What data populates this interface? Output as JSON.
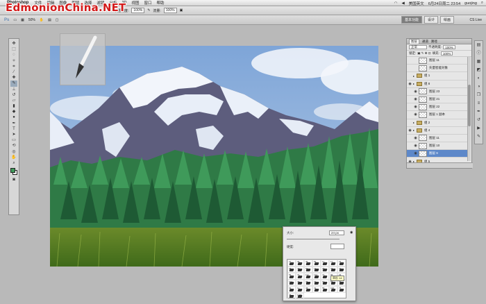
{
  "menubar": {
    "app": "Photoshop",
    "menus": [
      "文件",
      "编辑",
      "图像",
      "图层",
      "选择",
      "滤镜",
      "分析",
      "3D",
      "视图",
      "窗口",
      "帮助"
    ],
    "status_flag": "美国英文",
    "datetime": "6月24日周二 23:54",
    "user": "guojing"
  },
  "watermark": "EdmonionChina.NET",
  "optbar": {
    "opacity_label": "不透明度:",
    "opacity_value": "100%",
    "flow_label": "流量:",
    "flow_value": "100%"
  },
  "appbar": {
    "app_label": "Ps",
    "zoom": "50%",
    "workspaces": [
      "基本功能",
      "设计",
      "绘画"
    ],
    "cs_live": "CS Live"
  },
  "layers_panel": {
    "tabs": [
      "图层",
      "通道",
      "路径"
    ],
    "blend_mode": "正常",
    "opacity_label": "不透明度:",
    "opacity_value": "100%",
    "lock_label": "锁定:",
    "fill_label": "填充:",
    "fill_value": "100%",
    "rows": [
      {
        "name": "图层 11",
        "kind": "layer",
        "visible": false,
        "indent": true,
        "selected": false
      },
      {
        "name": "矢量智能对象",
        "kind": "layer",
        "visible": false,
        "indent": true,
        "selected": false
      },
      {
        "name": "组 1",
        "kind": "group",
        "visible": false,
        "indent": false,
        "selected": false
      },
      {
        "name": "组 8",
        "kind": "group",
        "visible": true,
        "indent": false,
        "selected": false
      },
      {
        "name": "图层 23",
        "kind": "layer",
        "visible": true,
        "indent": true,
        "selected": false
      },
      {
        "name": "图层 21",
        "kind": "layer",
        "visible": true,
        "indent": true,
        "selected": false
      },
      {
        "name": "图层 22",
        "kind": "layer",
        "visible": true,
        "indent": true,
        "selected": false
      },
      {
        "name": "图层 1 副本",
        "kind": "layer",
        "visible": true,
        "indent": true,
        "selected": false
      },
      {
        "name": "组 2",
        "kind": "group",
        "visible": false,
        "indent": false,
        "selected": false
      },
      {
        "name": "组 4",
        "kind": "group",
        "visible": true,
        "indent": false,
        "selected": false
      },
      {
        "name": "图层 11",
        "kind": "layer",
        "visible": true,
        "indent": true,
        "selected": false
      },
      {
        "name": "图层 10",
        "kind": "layer",
        "visible": true,
        "indent": true,
        "selected": false
      },
      {
        "name": "图层 9",
        "kind": "layer",
        "visible": true,
        "indent": true,
        "selected": true
      },
      {
        "name": "组 5",
        "kind": "group",
        "visible": true,
        "indent": false,
        "selected": false
      }
    ]
  },
  "brush_panel": {
    "size_label": "大小:",
    "size_value": "24 px",
    "hardness_label": "硬度:",
    "tooltip": "草形 14",
    "brush_numbers": [
      "27",
      "39",
      "46",
      "59",
      "11",
      "17",
      "23",
      "36",
      "44",
      "60",
      "14",
      "26",
      "33",
      "42",
      "55",
      "70",
      "112",
      "134",
      "74",
      "95",
      "29",
      "192",
      "36",
      "36",
      "33",
      "63",
      "66",
      "39",
      "63",
      "11",
      "48",
      "32",
      "55",
      "100",
      "75",
      "45",
      "1106"
    ]
  },
  "toolbox": {
    "tools": [
      "move",
      "marquee",
      "lasso",
      "quick-select",
      "crop",
      "eyedropper",
      "heal",
      "brush",
      "stamp",
      "history",
      "eraser",
      "gradient",
      "blur",
      "dodge",
      "pen",
      "type",
      "path-select",
      "shape",
      "3d-rotate",
      "3d-orbit",
      "hand",
      "zoom"
    ],
    "foreground_color": "#3f9a5a",
    "background_color": "#ffffff"
  }
}
